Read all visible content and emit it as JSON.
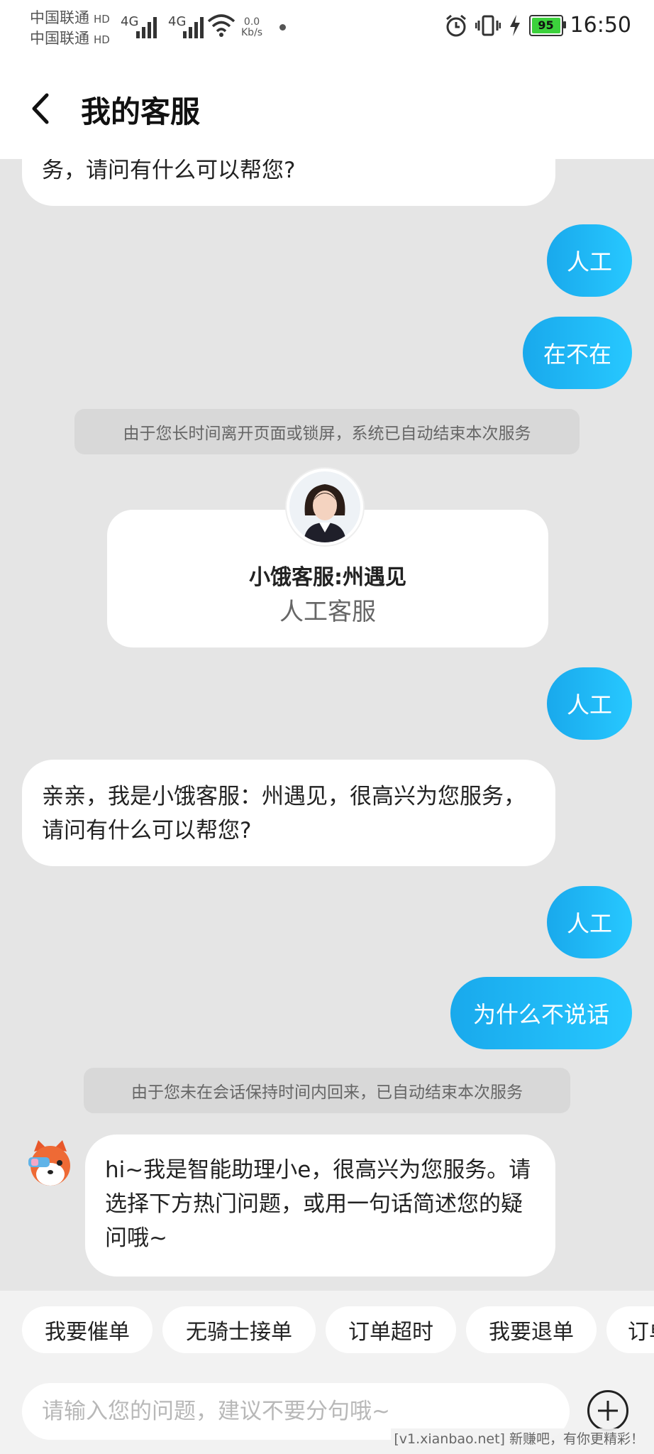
{
  "status_bar": {
    "carrier1": "中国联通",
    "carrier2": "中国联通",
    "hd": "HD",
    "net1": "4G",
    "net2": "4G",
    "speed_value": "0.0",
    "speed_unit": "Kb/s",
    "battery": "95",
    "time": "16:50"
  },
  "header": {
    "title": "我的客服",
    "back_icon": "chevron-left-icon"
  },
  "messages": {
    "top_partial": "务，请问有什么可以帮您?",
    "out1": "人工",
    "out2": "在不在",
    "system1": "由于您长时间离开页面或锁屏，系统已自动结束本次服务",
    "agent_name": "小饿客服:州遇见",
    "agent_role": "人工客服",
    "out3": "人工",
    "in1": "亲亲，我是小饿客服：州遇见，很高兴为您服务，请问有什么可以帮您?",
    "out4": "人工",
    "out5": "为什么不说话",
    "system2": "由于您未在会话保持时间内回来，已自动结束本次服务",
    "bot": "hi~我是智能助理小e，很高兴为您服务。请选择下方热门问题，或用一句话简述您的疑问哦~"
  },
  "quick_replies": [
    "我要催单",
    "无骑士接单",
    "订单超时",
    "我要退单",
    "订单"
  ],
  "input": {
    "placeholder": "请输入您的问题，建议不要分句哦~",
    "value": ""
  },
  "watermark": "[v1.xianbao.net] 新赚吧，有你更精彩！",
  "colors": {
    "accent": "#1fb4f5",
    "background": "#e5e5e5"
  }
}
